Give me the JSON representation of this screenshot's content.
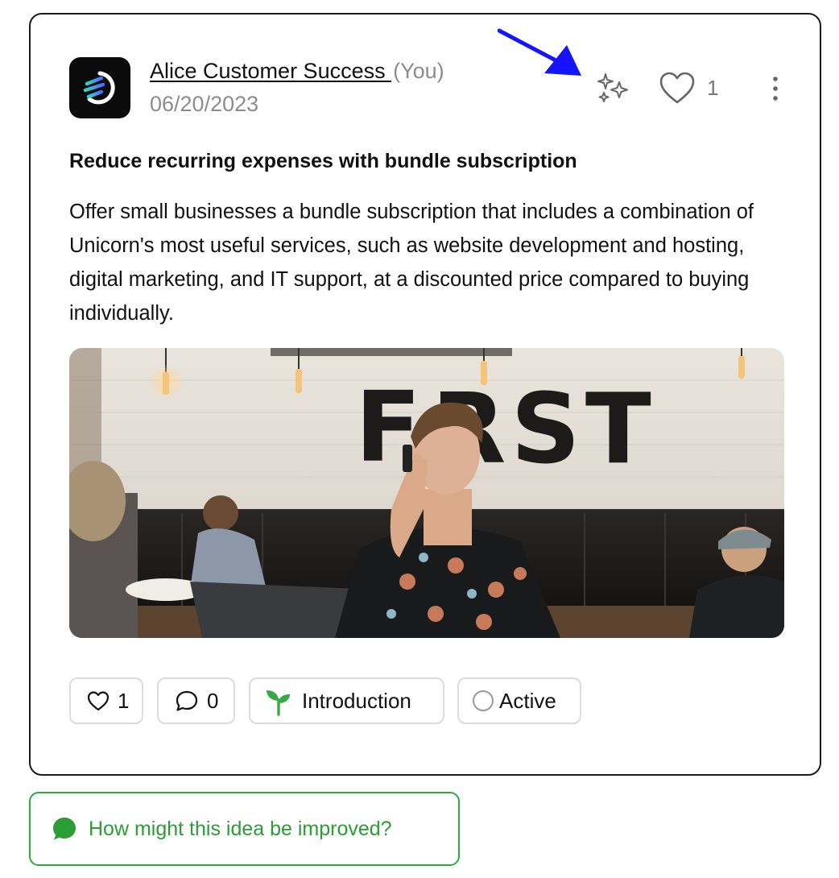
{
  "post": {
    "author": "Alice Customer Success ",
    "you_tag": "(You)",
    "date": "06/20/2023",
    "like_count": "1",
    "title": "Reduce recurring expenses with bundle subscription",
    "body": "Offer small businesses a bundle subscription that includes a combination of Unicorn's most useful services, such as website development and hosting, digital marketing, and IT support, at a discounted price compared to buying individually."
  },
  "footer": {
    "likes": "1",
    "comments": "0",
    "tag_label": "Introduction",
    "status_label": "Active"
  },
  "improve_prompt": "How might this idea be improved?",
  "icons": {
    "avatar": "logo-icon",
    "sparkle": "sparkles-icon",
    "like": "heart-icon",
    "more": "vertical-dots-icon",
    "comment": "speech-bubble-icon",
    "tag": "sprout-icon",
    "status": "circle-icon",
    "improve": "chat-bubble-icon",
    "annotation": "arrow-icon"
  },
  "colors": {
    "accent_green": "#2a9d34",
    "arrow_blue": "#1414ff",
    "muted_gray": "#8c8c8c",
    "border": "#1a1a1a"
  }
}
